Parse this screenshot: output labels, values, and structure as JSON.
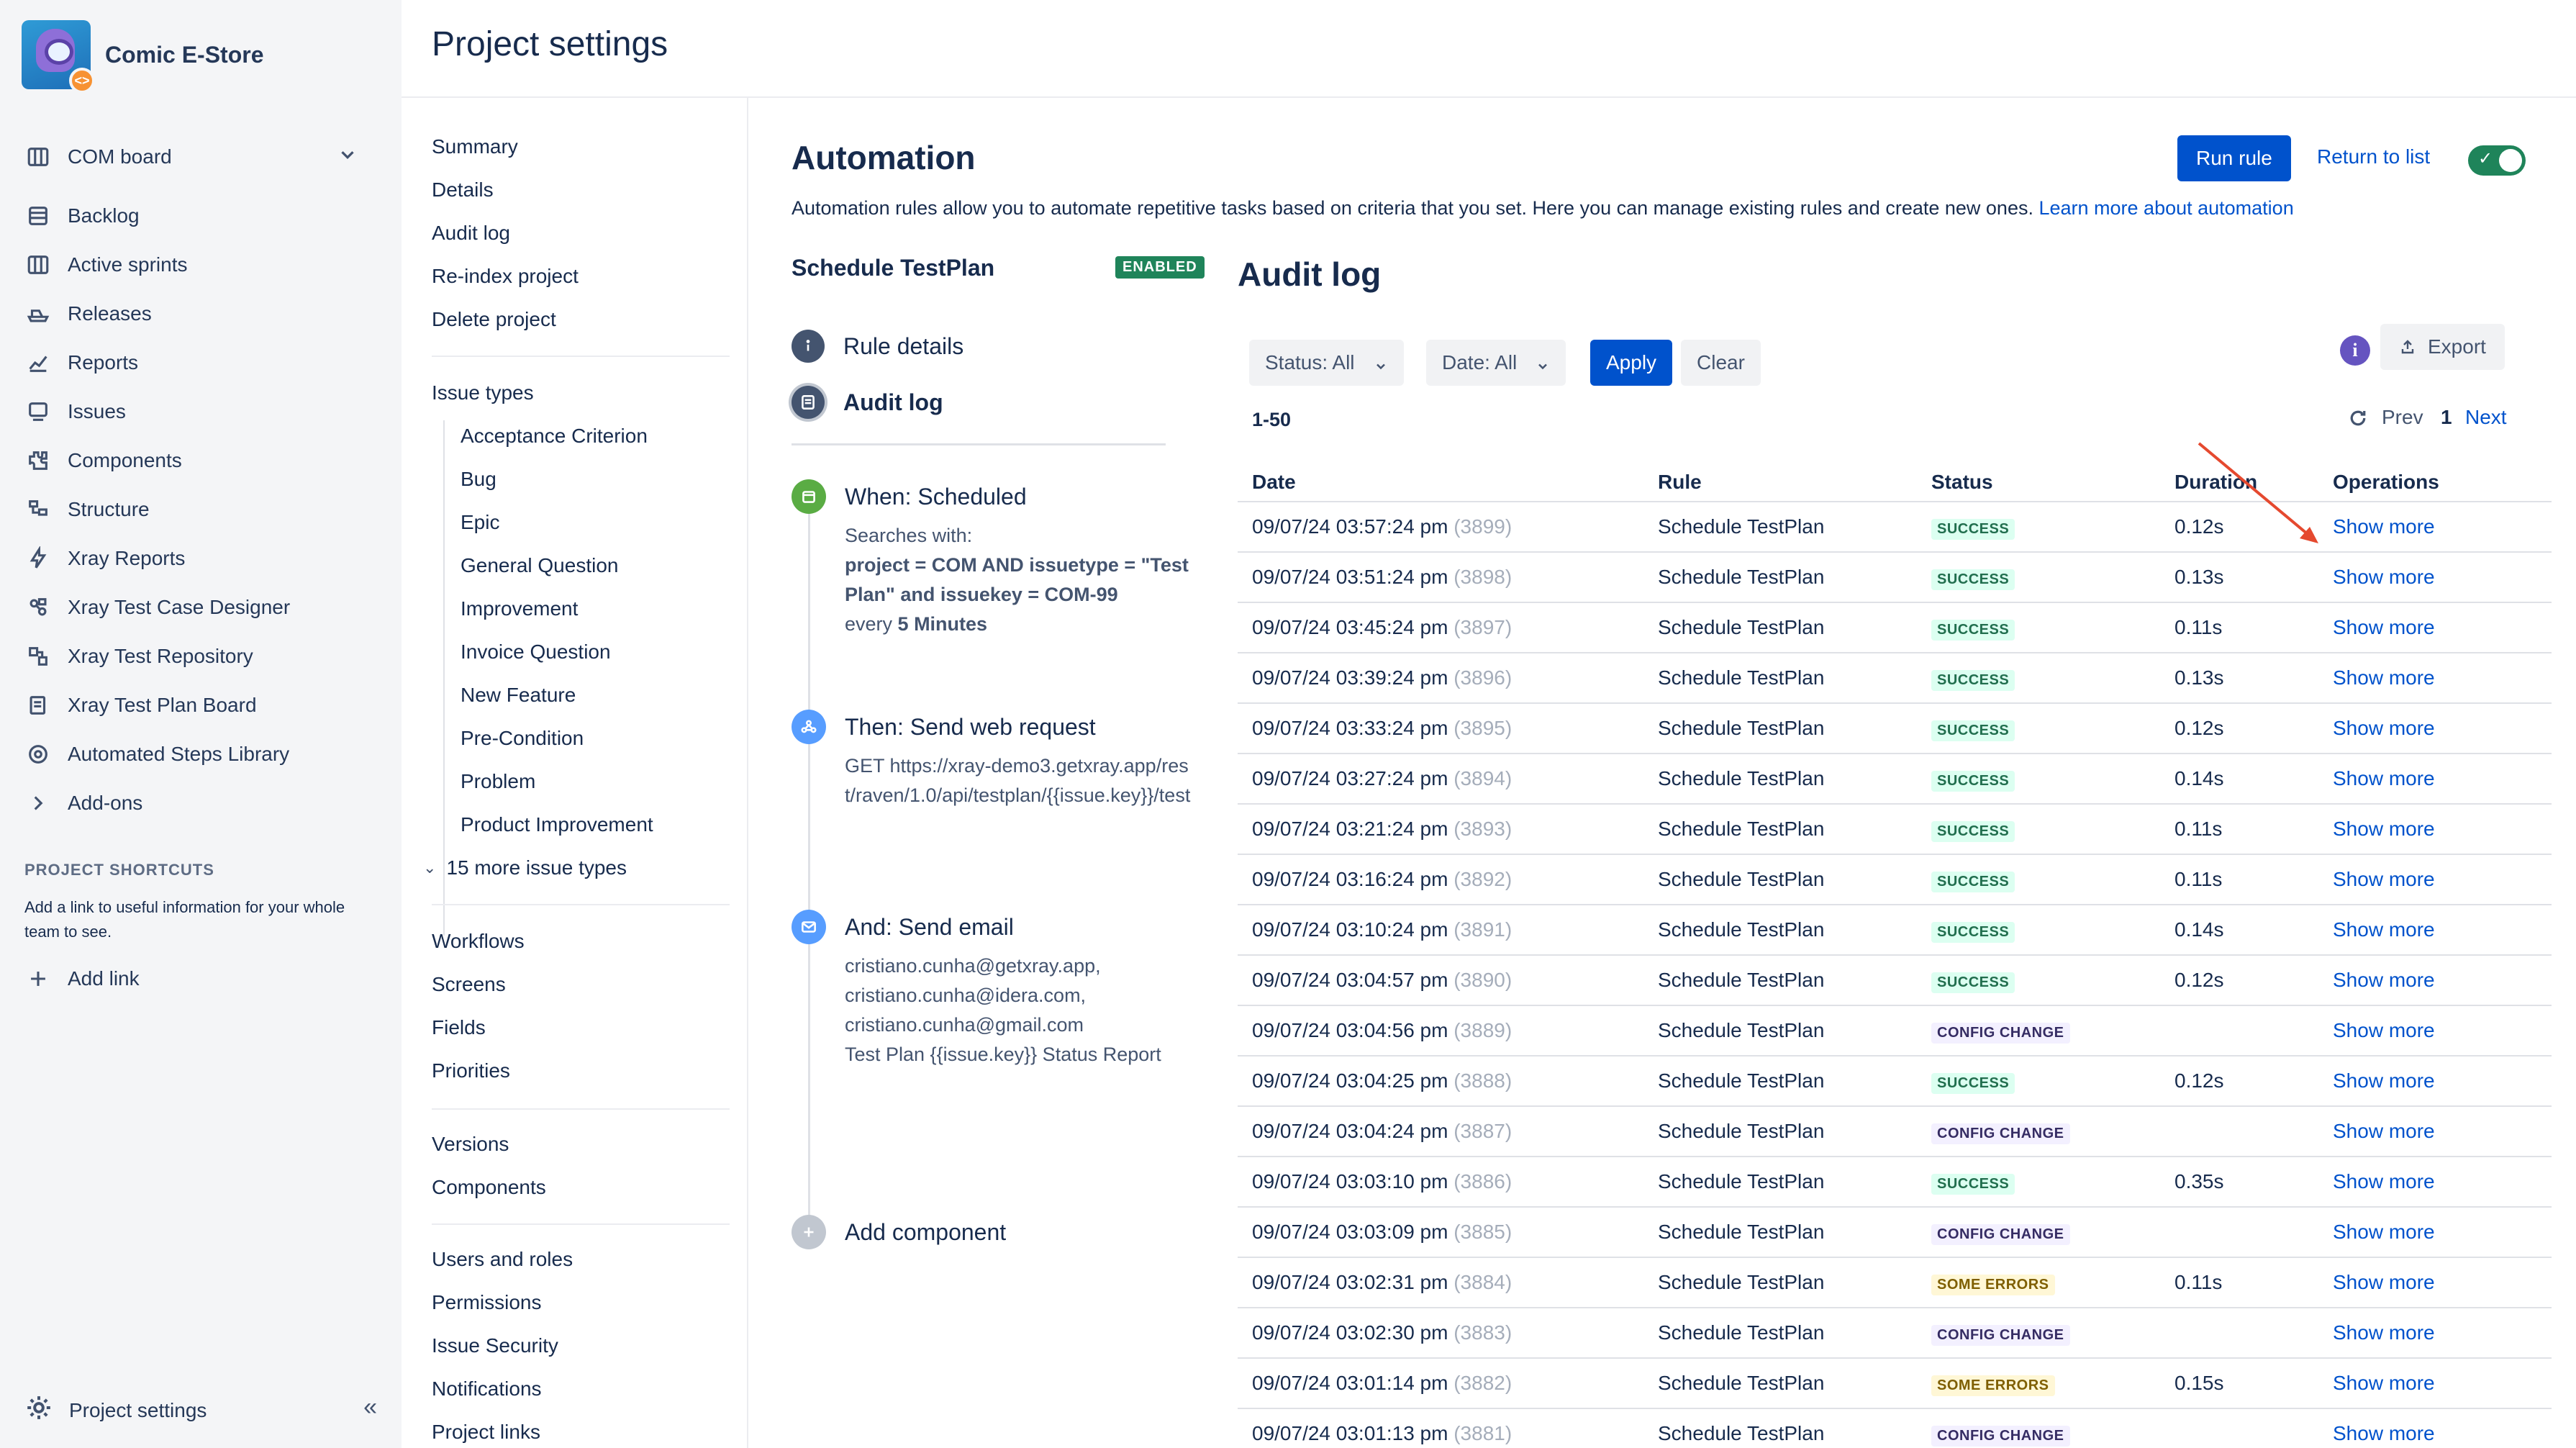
{
  "project": {
    "name": "Comic E-Store",
    "avatar_badge": "<>"
  },
  "leftnav": {
    "board": "COM board",
    "items": [
      {
        "label": "Backlog",
        "icon": "backlog-icon"
      },
      {
        "label": "Active sprints",
        "icon": "board-icon"
      },
      {
        "label": "Releases",
        "icon": "ship-icon"
      },
      {
        "label": "Reports",
        "icon": "chart-icon"
      },
      {
        "label": "Issues",
        "icon": "issues-icon"
      },
      {
        "label": "Components",
        "icon": "puzzle-icon"
      },
      {
        "label": "Structure",
        "icon": "structure-icon"
      },
      {
        "label": "Xray Reports",
        "icon": "bolt-icon"
      },
      {
        "label": "Xray Test Case Designer",
        "icon": "designer-icon"
      },
      {
        "label": "Xray Test Repository",
        "icon": "repository-icon"
      },
      {
        "label": "Xray Test Plan Board",
        "icon": "plan-board-icon"
      },
      {
        "label": "Automated Steps Library",
        "icon": "library-icon"
      },
      {
        "label": "Add-ons",
        "icon": "chevron-right-icon"
      }
    ],
    "shortcuts_title": "PROJECT SHORTCUTS",
    "shortcuts_help": "Add a link to useful information for your whole team to see.",
    "add_link": "Add link",
    "footer": "Project settings",
    "collapse": "«"
  },
  "header": {
    "title": "Project settings"
  },
  "settings_nav": {
    "group1": [
      "Summary",
      "Details",
      "Audit log",
      "Re-index project",
      "Delete project"
    ],
    "issue_types_title": "Issue types",
    "issue_types": [
      "Acceptance Criterion",
      "Bug",
      "Epic",
      "General Question",
      "Improvement",
      "Invoice Question",
      "New Feature",
      "Pre-Condition",
      "Problem",
      "Product Improvement"
    ],
    "more_issue_types": "15 more issue types",
    "group3": [
      "Workflows",
      "Screens",
      "Fields",
      "Priorities"
    ],
    "group4": [
      "Versions",
      "Components"
    ],
    "group5": [
      "Users and roles",
      "Permissions",
      "Issue Security",
      "Notifications",
      "Project links"
    ]
  },
  "automation": {
    "title": "Automation",
    "description": "Automation rules allow you to automate repetitive tasks based on criteria that you set. Here you can manage existing rules and create new ones.",
    "learn_more": "Learn more about automation",
    "run_rule": "Run rule",
    "return_to_list": "Return to list",
    "toggle_check": "✓",
    "rule_name": "Schedule TestPlan",
    "rule_status": "ENABLED",
    "rule_nav": [
      "Rule details",
      "Audit log"
    ],
    "steps": {
      "when": {
        "title": "When: Scheduled",
        "searches_with": "Searches with:",
        "jql": "project = COM AND issuetype = \"Test Plan\" and issuekey = COM-99",
        "every": "every",
        "interval": "5 Minutes"
      },
      "then": {
        "title": "Then: Send web request",
        "body": "GET https://xray-demo3.getxray.app/rest/raven/1.0/api/testplan/{{issue.key}}/test"
      },
      "and": {
        "title": "And: Send email",
        "lines": [
          "cristiano.cunha@getxray.app,",
          "cristiano.cunha@idera.com,",
          "cristiano.cunha@gmail.com",
          "Test Plan {{issue.key}} Status Report"
        ]
      },
      "add_component": "Add component"
    }
  },
  "audit": {
    "title": "Audit log",
    "status_filter": "Status: All",
    "date_filter": "Date: All",
    "apply": "Apply",
    "clear": "Clear",
    "info": "i",
    "export": "Export",
    "range": "1-50",
    "prev": "Prev",
    "page": "1",
    "next": "Next",
    "columns": [
      "Date",
      "Rule",
      "Status",
      "Duration",
      "Operations"
    ],
    "rows": [
      {
        "date": "09/07/24 03:57:24 pm",
        "id": "(3899)",
        "rule": "Schedule TestPlan",
        "status": "SUCCESS",
        "kind": "success",
        "duration": "0.12s",
        "op": "Show more"
      },
      {
        "date": "09/07/24 03:51:24 pm",
        "id": "(3898)",
        "rule": "Schedule TestPlan",
        "status": "SUCCESS",
        "kind": "success",
        "duration": "0.13s",
        "op": "Show more"
      },
      {
        "date": "09/07/24 03:45:24 pm",
        "id": "(3897)",
        "rule": "Schedule TestPlan",
        "status": "SUCCESS",
        "kind": "success",
        "duration": "0.11s",
        "op": "Show more"
      },
      {
        "date": "09/07/24 03:39:24 pm",
        "id": "(3896)",
        "rule": "Schedule TestPlan",
        "status": "SUCCESS",
        "kind": "success",
        "duration": "0.13s",
        "op": "Show more"
      },
      {
        "date": "09/07/24 03:33:24 pm",
        "id": "(3895)",
        "rule": "Schedule TestPlan",
        "status": "SUCCESS",
        "kind": "success",
        "duration": "0.12s",
        "op": "Show more"
      },
      {
        "date": "09/07/24 03:27:24 pm",
        "id": "(3894)",
        "rule": "Schedule TestPlan",
        "status": "SUCCESS",
        "kind": "success",
        "duration": "0.14s",
        "op": "Show more"
      },
      {
        "date": "09/07/24 03:21:24 pm",
        "id": "(3893)",
        "rule": "Schedule TestPlan",
        "status": "SUCCESS",
        "kind": "success",
        "duration": "0.11s",
        "op": "Show more"
      },
      {
        "date": "09/07/24 03:16:24 pm",
        "id": "(3892)",
        "rule": "Schedule TestPlan",
        "status": "SUCCESS",
        "kind": "success",
        "duration": "0.11s",
        "op": "Show more"
      },
      {
        "date": "09/07/24 03:10:24 pm",
        "id": "(3891)",
        "rule": "Schedule TestPlan",
        "status": "SUCCESS",
        "kind": "success",
        "duration": "0.14s",
        "op": "Show more"
      },
      {
        "date": "09/07/24 03:04:57 pm",
        "id": "(3890)",
        "rule": "Schedule TestPlan",
        "status": "SUCCESS",
        "kind": "success",
        "duration": "0.12s",
        "op": "Show more"
      },
      {
        "date": "09/07/24 03:04:56 pm",
        "id": "(3889)",
        "rule": "Schedule TestPlan",
        "status": "CONFIG CHANGE",
        "kind": "config",
        "duration": "",
        "op": "Show more"
      },
      {
        "date": "09/07/24 03:04:25 pm",
        "id": "(3888)",
        "rule": "Schedule TestPlan",
        "status": "SUCCESS",
        "kind": "success",
        "duration": "0.12s",
        "op": "Show more"
      },
      {
        "date": "09/07/24 03:04:24 pm",
        "id": "(3887)",
        "rule": "Schedule TestPlan",
        "status": "CONFIG CHANGE",
        "kind": "config",
        "duration": "",
        "op": "Show more"
      },
      {
        "date": "09/07/24 03:03:10 pm",
        "id": "(3886)",
        "rule": "Schedule TestPlan",
        "status": "SUCCESS",
        "kind": "success",
        "duration": "0.35s",
        "op": "Show more"
      },
      {
        "date": "09/07/24 03:03:09 pm",
        "id": "(3885)",
        "rule": "Schedule TestPlan",
        "status": "CONFIG CHANGE",
        "kind": "config",
        "duration": "",
        "op": "Show more"
      },
      {
        "date": "09/07/24 03:02:31 pm",
        "id": "(3884)",
        "rule": "Schedule TestPlan",
        "status": "SOME ERRORS",
        "kind": "errors",
        "duration": "0.11s",
        "op": "Show more"
      },
      {
        "date": "09/07/24 03:02:30 pm",
        "id": "(3883)",
        "rule": "Schedule TestPlan",
        "status": "CONFIG CHANGE",
        "kind": "config",
        "duration": "",
        "op": "Show more"
      },
      {
        "date": "09/07/24 03:01:14 pm",
        "id": "(3882)",
        "rule": "Schedule TestPlan",
        "status": "SOME ERRORS",
        "kind": "errors",
        "duration": "0.15s",
        "op": "Show more"
      },
      {
        "date": "09/07/24 03:01:13 pm",
        "id": "(3881)",
        "rule": "Schedule TestPlan",
        "status": "CONFIG CHANGE",
        "kind": "config",
        "duration": "",
        "op": "Show more"
      }
    ]
  },
  "colors": {
    "primary": "#0052cc",
    "enabled": "#1f845a",
    "annotation": "#e5492f"
  }
}
